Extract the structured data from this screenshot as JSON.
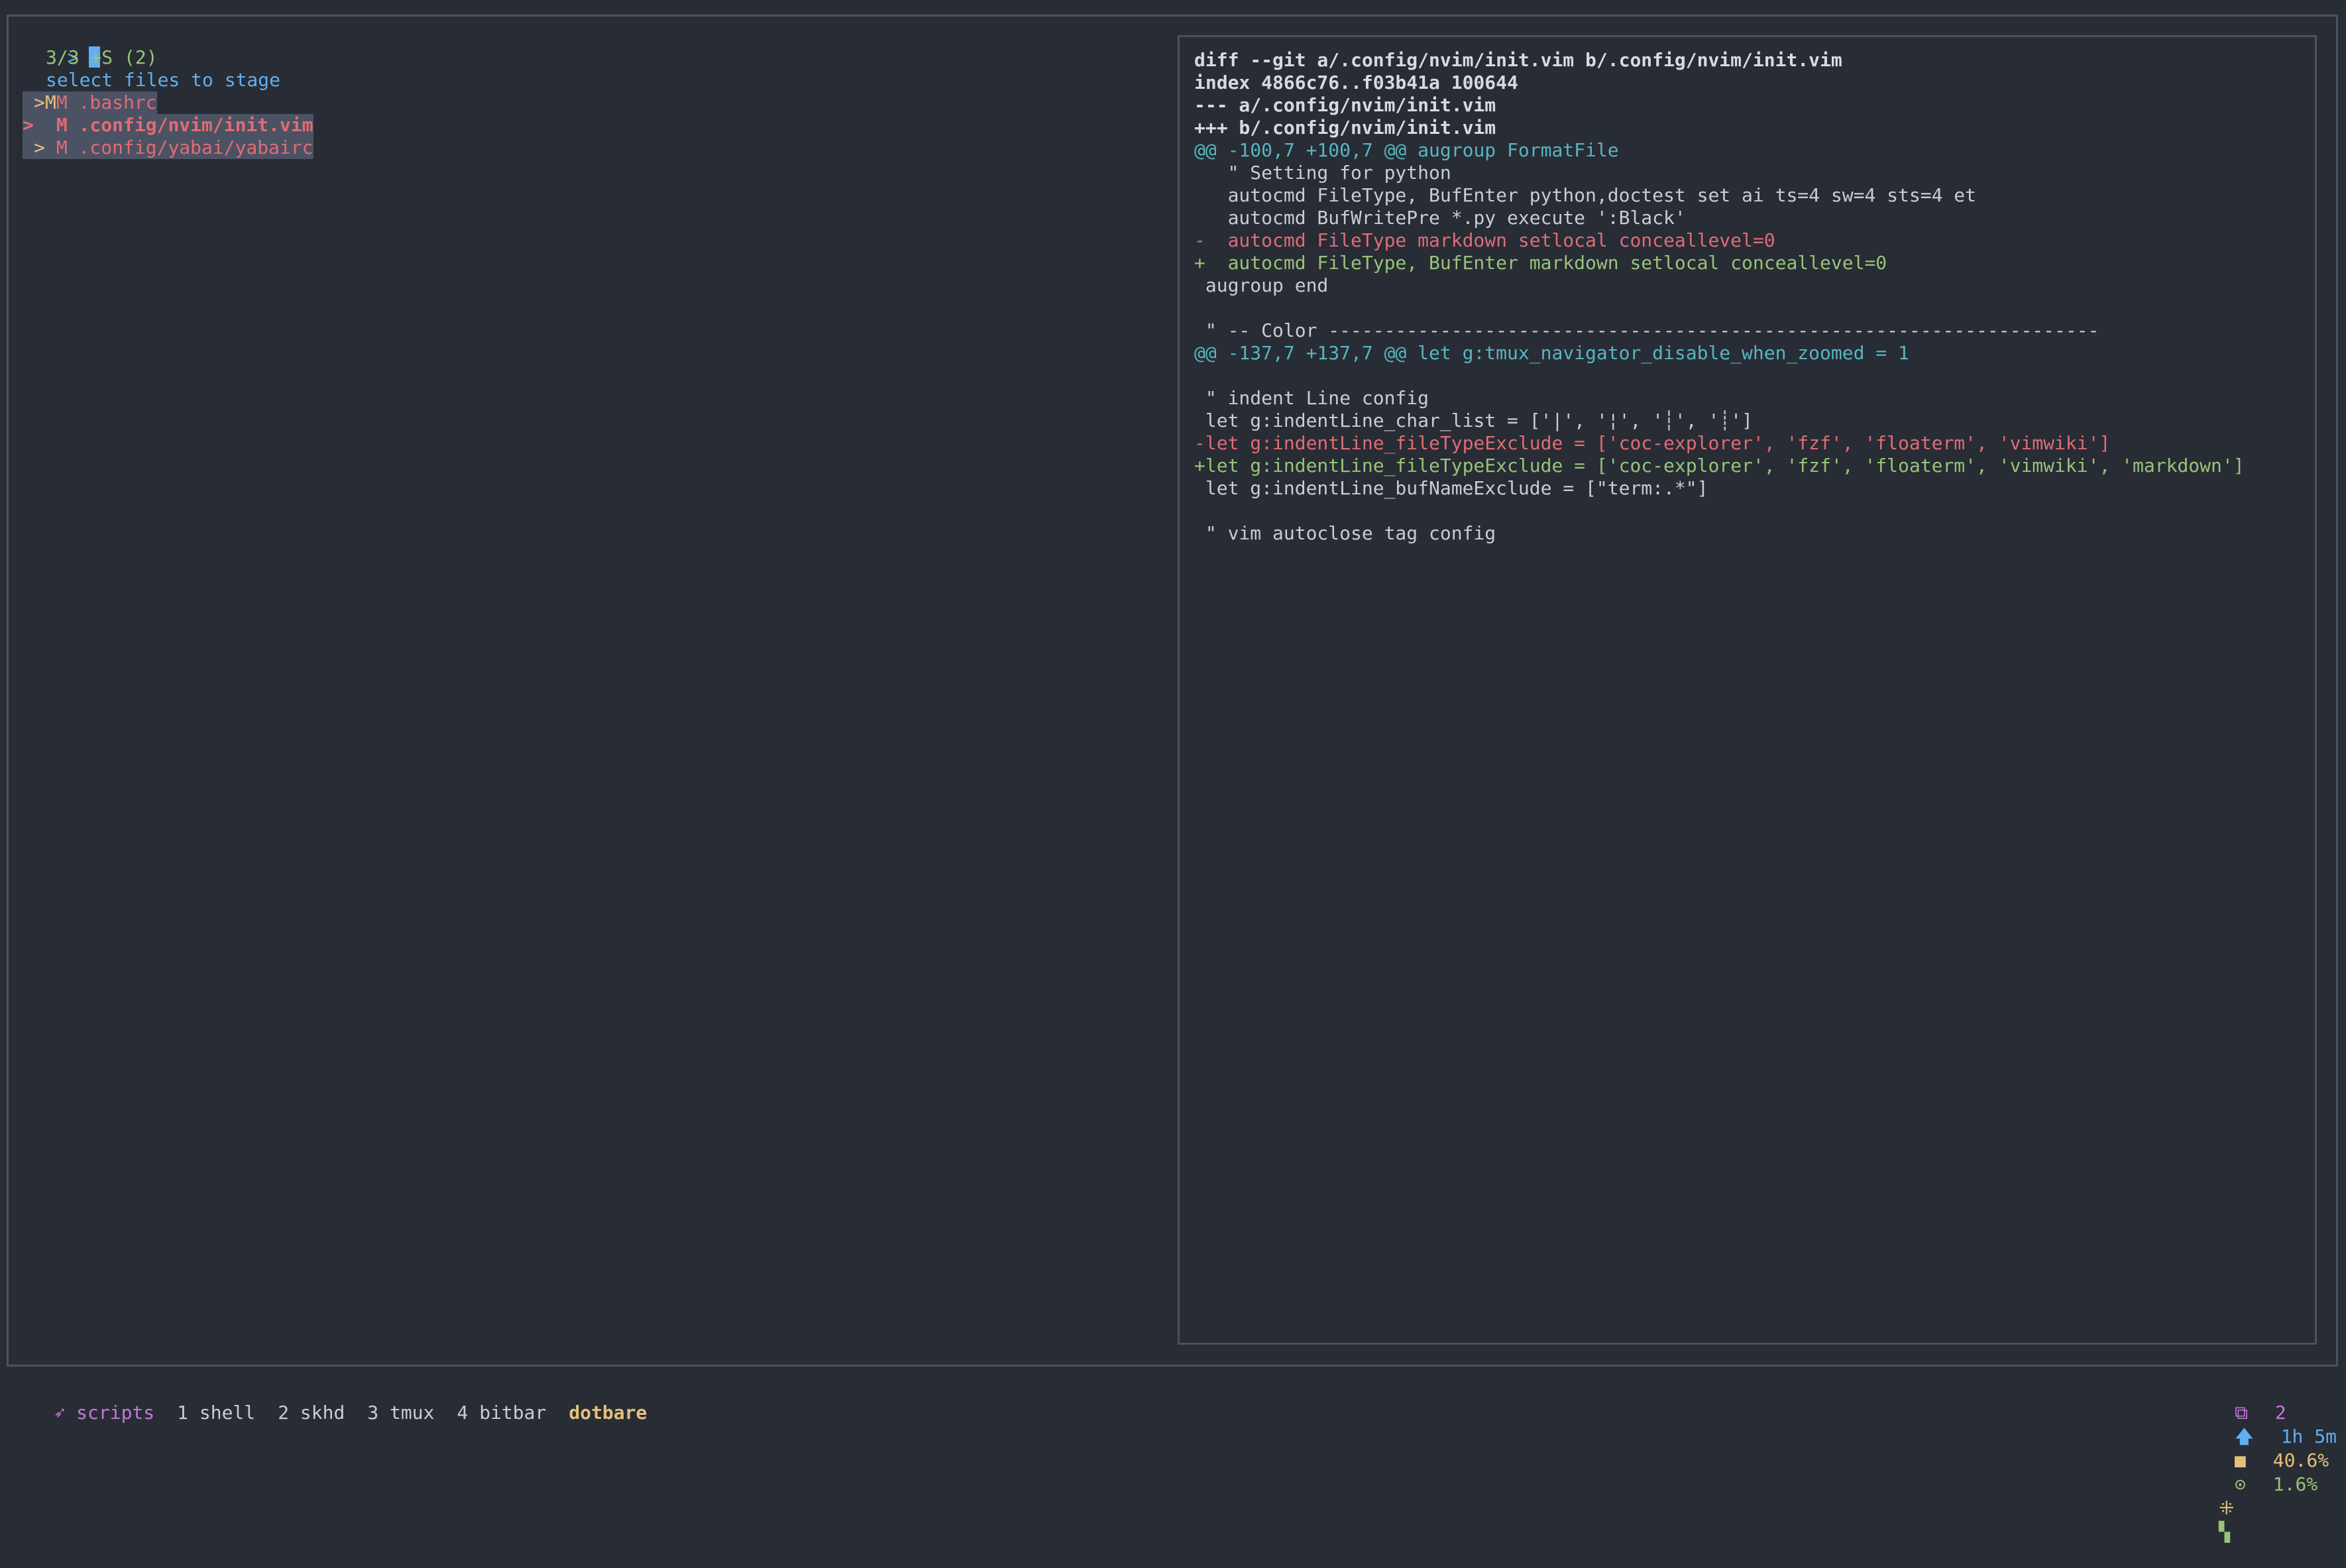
{
  "finder": {
    "prompt": ">",
    "query": "",
    "count": "3/3 +S (2)",
    "header": "select files to stage",
    "files": [
      {
        "marker": ">",
        "pointer": "",
        "status_x": "M",
        "status_y": "M",
        "name": ".bashrc",
        "selected": true,
        "current": false
      },
      {
        "marker": "",
        "pointer": ">",
        "status_x": " ",
        "status_y": "M",
        "name": ".config/nvim/init.vim",
        "selected": true,
        "current": true
      },
      {
        "marker": ">",
        "pointer": "",
        "status_x": " ",
        "status_y": "M",
        "name": ".config/yabai/yabairc",
        "selected": true,
        "current": false
      }
    ]
  },
  "preview": {
    "lines": [
      {
        "type": "meta",
        "text": "diff --git a/.config/nvim/init.vim b/.config/nvim/init.vim"
      },
      {
        "type": "meta",
        "text": "index 4866c76..f03b41a 100644"
      },
      {
        "type": "meta",
        "text": "--- a/.config/nvim/init.vim"
      },
      {
        "type": "meta",
        "text": "+++ b/.config/nvim/init.vim"
      },
      {
        "type": "hunk",
        "hunk": "@@ -100,7 +100,7 @@",
        "text": " augroup FormatFile"
      },
      {
        "type": "ctx",
        "text": "   \" Setting for python"
      },
      {
        "type": "ctx",
        "text": "   autocmd FileType, BufEnter python,doctest set ai ts=4 sw=4 sts=4 et"
      },
      {
        "type": "ctx",
        "text": "   autocmd BufWritePre *.py execute ':Black'"
      },
      {
        "type": "minus",
        "text": "-  autocmd FileType markdown setlocal conceallevel=0"
      },
      {
        "type": "plus",
        "text": "+  autocmd FileType, BufEnter markdown setlocal conceallevel=0"
      },
      {
        "type": "ctx",
        "text": " augroup end"
      },
      {
        "type": "ctx",
        "text": ""
      },
      {
        "type": "ctx",
        "text": " \" -- Color ---------------------------------------------------------------------"
      },
      {
        "type": "hunk",
        "hunk": "@@ -137,7 +137,7 @@",
        "text": " let g:tmux_navigator_disable_when_zoomed = 1"
      },
      {
        "type": "ctx",
        "text": ""
      },
      {
        "type": "ctx",
        "text": " \" indent Line config"
      },
      {
        "type": "ctx",
        "text": " let g:indentLine_char_list = ['|', '¦', '┆', '┊']"
      },
      {
        "type": "minus",
        "text": "-let g:indentLine_fileTypeExclude = ['coc-explorer', 'fzf', 'floaterm', 'vimwiki']"
      },
      {
        "type": "plus",
        "text": "+let g:indentLine_fileTypeExclude = ['coc-explorer', 'fzf', 'floaterm', 'vimwiki', 'markdown']"
      },
      {
        "type": "ctx",
        "text": " let g:indentLine_bufNameExclude = [\"term:.*\"]"
      },
      {
        "type": "ctx",
        "text": ""
      },
      {
        "type": "ctx",
        "text": " \" vim autoclose tag config"
      }
    ]
  },
  "statusbar": {
    "session_icon": "➶",
    "session": "scripts",
    "windows": [
      {
        "label": "1 shell",
        "active": false
      },
      {
        "label": "2 skhd",
        "active": false
      },
      {
        "label": "3 tmux",
        "active": false
      },
      {
        "label": "4 bitbar",
        "active": false
      },
      {
        "label": "dotbare",
        "active": true
      }
    ],
    "right": {
      "panes_icon": "⧉",
      "panes": "2",
      "uptime_icon": "🡅",
      "uptime": "1h 5m",
      "mem_icon": "■",
      "mem": "40.6%",
      "cpu_icon": "⊙",
      "cpu": "1.6%",
      "prefix_icon": "⁜",
      "layout_icon": "▚"
    }
  }
}
